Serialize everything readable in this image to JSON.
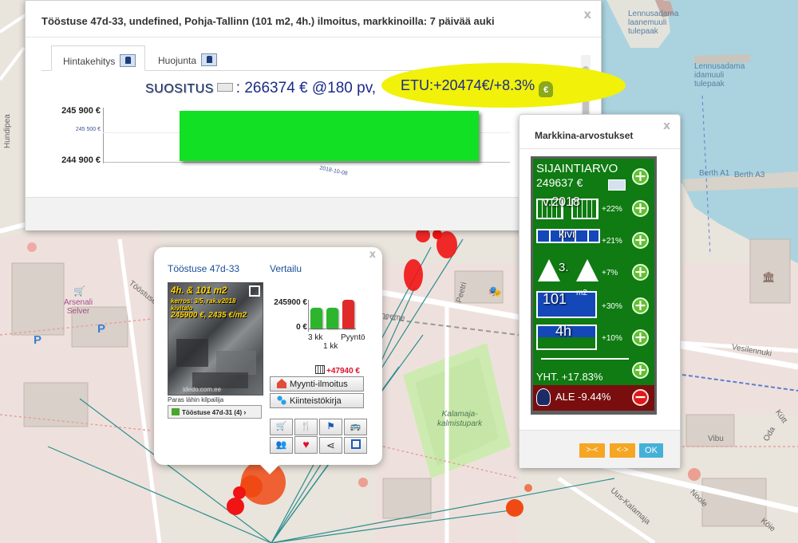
{
  "map": {
    "labels": {
      "lennusadama_laanemuuli": "Lennusadama\nlaanemuuli\ntulepaak",
      "lennusadama_idamuuli": "Lennusadama\nidamuuli\ntulepaak",
      "berth_a1": "Berth A1",
      "berth_a3": "Berth A3",
      "arsenali": "Arsenali\nSelver",
      "parking": "P",
      "kalamaja_park": "Kalamaja-\nkalmistupark",
      "hundipea": "Hundipea",
      "vesilennuki": "Vesilennuki",
      "vibu": "Vibu",
      "oda": "Oda",
      "noole": "Noole",
      "kole": "Köie",
      "kutt": "Kütt",
      "uus_kalamaja": "Uus-Kalamaja",
      "peetri": "Peetri",
      "tööstuse_street": "Tööstuse",
      "neeme": "neeme"
    }
  },
  "price_window": {
    "title": "Tööstuse 47d-33, undefined, Pohja-Tallinn (101 m2, 4h.) ilmoitus, markkinoilla: 7 päivää auki",
    "close": "x",
    "tabs": [
      {
        "label": "Hintakehitys",
        "icon": "person-icon",
        "active": true
      },
      {
        "label": "Huojunta",
        "icon": "person-icon",
        "active": false
      }
    ],
    "suositus_label": "SUOSITUS",
    "suositus_value": ": 266374 € @180 pv,",
    "etu_text": "ETU:+20474€/+8.3%",
    "etu_bag": "€",
    "footer_btn": ">-",
    "chart": {
      "y_top": "245 900 €",
      "y_mid": "245 500 €",
      "y_bottom": "244 900 €",
      "date": "2018-10-08"
    }
  },
  "chart_data": {
    "type": "bar",
    "title": "",
    "categories": [
      "2018-10-08"
    ],
    "values": [
      245900
    ],
    "ylim": [
      244900,
      245900
    ],
    "yticks": [
      "245 900 €",
      "245 500 €",
      "244 900 €"
    ],
    "xlabel": "",
    "ylabel": "",
    "color": "#12e025"
  },
  "property_popup": {
    "close": "x",
    "address_link": "Tööstuse 47d-33",
    "compare_link": "Vertailu",
    "photo": {
      "line1": "4h. & 101 m2",
      "line2": "kerros: 3/5, rak.v2018",
      "line3": "kivitalo",
      "line4": "245900 €, 2435 €/m2",
      "watermark": "idedo.com.ee"
    },
    "best_competitor_label": "Paras lähin kilpailija",
    "competitor_btn": "Tööstuse 47d-31 (4)",
    "mini_chart": {
      "y_top": "245900 €",
      "y_zero": "0 €",
      "label_3kk": "3 kk",
      "label_pyynto": "Pyyntö",
      "label_1kk": "1 kk",
      "bars": [
        {
          "name": "3 kk",
          "value": 0.72,
          "color": "#2db52d"
        },
        {
          "name": "1 kk",
          "value": 0.72,
          "color": "#2db52d"
        },
        {
          "name": "Pyyntö",
          "value": 1.0,
          "color": "#e02a2a"
        }
      ]
    },
    "diff": "+47940 €",
    "btn_listing": "Myynti-ilmoitus",
    "btn_registry": "Kiinteistökirja"
  },
  "valuation_panel": {
    "title": "Markkina-arvostukset",
    "close": "x",
    "sijaintiarvo_label": "SIJAINTIARVO",
    "sijaintiarvo_value": "249637 €",
    "year_label": "v.2018",
    "year_pct": "+22%",
    "material_label": "kivi",
    "material_pct": "+21%",
    "floor_label": "3.",
    "floor_pct": "+7%",
    "area_label": "101",
    "area_unit": "m2",
    "area_pct": "+30%",
    "rooms_label": "4h",
    "rooms_pct": "+10%",
    "total_label": "YHT. +17.83%",
    "ale_label": "ALE -9.44%",
    "buttons": [
      ">-<",
      "<->",
      "OK"
    ]
  }
}
